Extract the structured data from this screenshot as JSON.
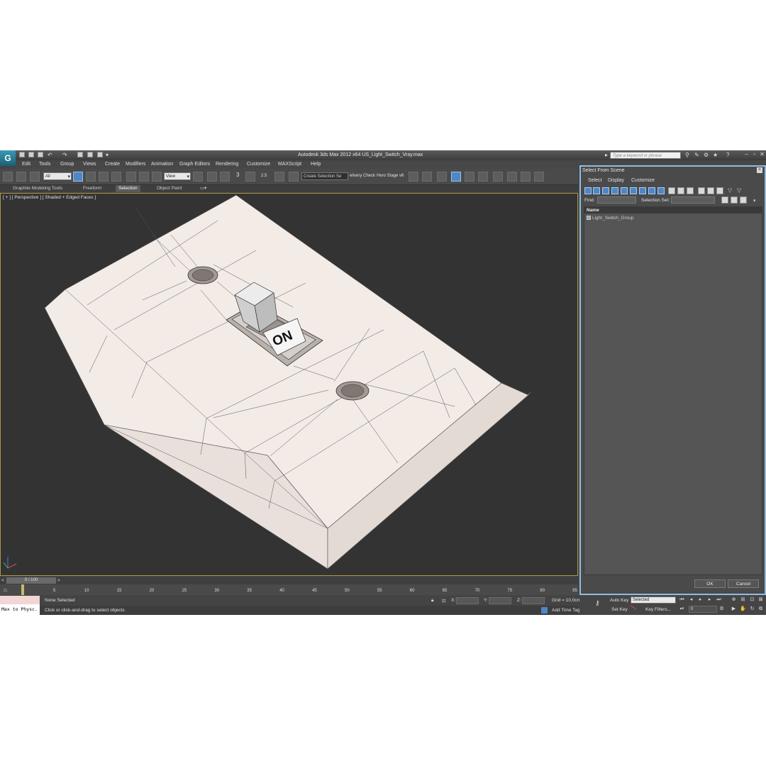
{
  "app": {
    "logo": "G",
    "title": "Autodesk 3ds Max  2012 x64      US_Light_Switch_Vray.max",
    "search_placeholder": "Type a keyword or phrase"
  },
  "menu": [
    "Edit",
    "Tools",
    "Group",
    "Views",
    "Create",
    "Modifiers",
    "Animation",
    "Graph Editors",
    "Rendering",
    "Customize",
    "MAXScript",
    "Help"
  ],
  "toolbar": {
    "filter": "All",
    "ref_coord": "View",
    "selection_set": "Create Selection Se",
    "delivery_check": "elivery Check",
    "stage": "Hero Stage v6",
    "snap_3": "3",
    "snap_25": "2.5"
  },
  "ribbon": {
    "tabs": [
      "Graphite Modeling Tools",
      "Freeform",
      "Selection",
      "Object Paint"
    ],
    "active": "Selection"
  },
  "viewport": {
    "label": "[ + ] [ Perspective ] [ Shaded + Edged Faces ]",
    "switch_label": "ON"
  },
  "timeline": {
    "frame": "0 / 100",
    "ticks": [
      "5",
      "10",
      "15",
      "20",
      "25",
      "30",
      "35",
      "40",
      "45",
      "50",
      "55",
      "60",
      "65",
      "70",
      "75",
      "80",
      "85"
    ]
  },
  "status": {
    "selection": "None Selected",
    "prompt": "Click or click-and-drag to select objects",
    "x_label": "X:",
    "y_label": "Y:",
    "z_label": "Z:",
    "grid": "Grid = 10,0cm",
    "add_time_tag": "Add Time Tag",
    "auto_key": "Auto Key",
    "selected": "Selected",
    "set_key": "Set Key",
    "key_filters": "Key Filters...",
    "frame_field": "0",
    "maxscript": "Max to Physc."
  },
  "panel": {
    "title": "Select From Scene",
    "menu": [
      "Select",
      "Display",
      "Customize"
    ],
    "find_label": "Find:",
    "selection_set_label": "Selection Set:",
    "column_name": "Name",
    "items": [
      "Light_Switch_Group"
    ],
    "ok": "OK",
    "cancel": "Cancel"
  },
  "colors": {
    "plate": "#f2e9e4",
    "plate_side": "#d9cdc7",
    "viewport_bg": "#333333",
    "accent_blue": "#4f86c6"
  }
}
